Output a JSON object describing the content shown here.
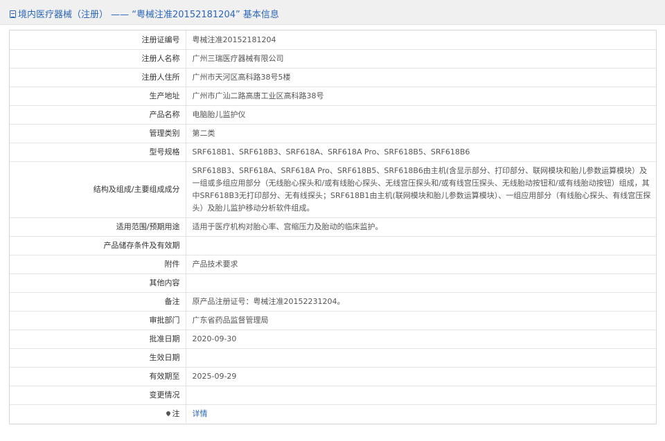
{
  "header": {
    "title": "境内医疗器械（注册） —— “粤械注准20152181204” 基本信息"
  },
  "rows": [
    {
      "label": "注册证编号",
      "value": "粤械注准20152181204"
    },
    {
      "label": "注册人名称",
      "value": "广州三瑞医疗器械有限公司"
    },
    {
      "label": "注册人住所",
      "value": "广州市天河区高科路38号5楼"
    },
    {
      "label": "生产地址",
      "value": "广州市广汕二路高唐工业区高科路38号"
    },
    {
      "label": "产品名称",
      "value": "电脑胎儿监护仪"
    },
    {
      "label": "管理类别",
      "value": "第二类"
    },
    {
      "label": "型号规格",
      "value": "SRF618B1、SRF618B3、SRF618A、SRF618A Pro、SRF618B5、SRF618B6"
    },
    {
      "label": "结构及组成/主要组成成分",
      "value": "SRF618B3、SRF618A、SRF618A Pro、SRF618B5、SRF618B6由主机(含显示部分、打印部分、联网模块和胎儿参数运算模块）及一组或多组应用部分（无线胎心探头和/或有线胎心探头、无线宫压探头和/或有线宫压探头、无线胎动按钮和/或有线胎动按钮）组成，其中SRF618B3无打印部分、无有线探头；SRF618B1由主机(联网模块和胎儿参数运算模块）、一组应用部分（有线胎心探头、有线宫压探头）及胎儿监护移动分析软件组成。"
    },
    {
      "label": "适用范围/预期用途",
      "value": "适用于医疗机构对胎心率、宫缩压力及胎动的临床监护。"
    },
    {
      "label": "产品储存条件及有效期",
      "value": ""
    },
    {
      "label": "附件",
      "value": "产品技术要求"
    },
    {
      "label": "其他内容",
      "value": ""
    },
    {
      "label": "备注",
      "value": "原产品注册证号：粤械注准20152231204。"
    },
    {
      "label": "审批部门",
      "value": "广东省药品监督管理局"
    },
    {
      "label": "批准日期",
      "value": "2020-09-30"
    },
    {
      "label": "生效日期",
      "value": ""
    },
    {
      "label": "有效期至",
      "value": "2025-09-29"
    },
    {
      "label": "变更情况",
      "value": ""
    }
  ],
  "note_row": {
    "label": "注",
    "link": "详情",
    "icon": "map-pin-icon"
  },
  "colors": {
    "accent": "#2b66b8",
    "header_bg": "#f0f0f0",
    "border": "#e3e3e3"
  }
}
